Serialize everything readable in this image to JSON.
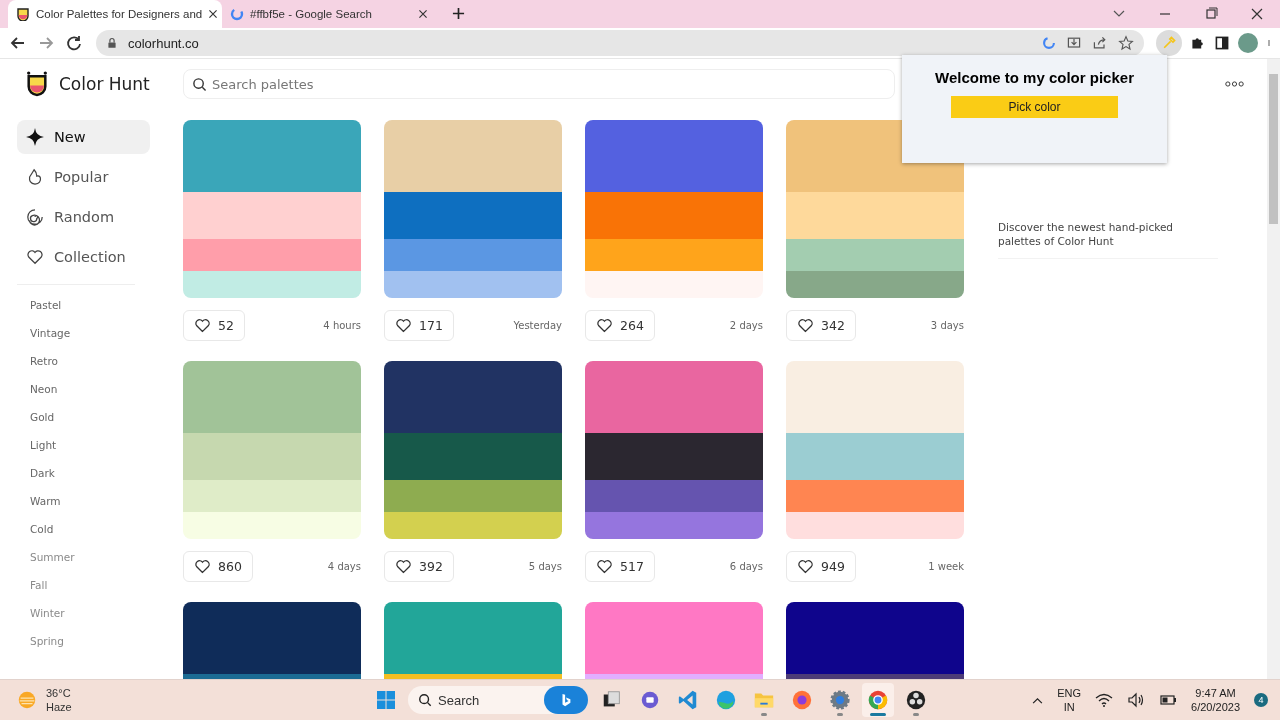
{
  "browser": {
    "tabs": [
      {
        "title": "Color Palettes for Designers and",
        "selected": true
      },
      {
        "title": "#ffbf5e - Google Search",
        "selected": false
      }
    ],
    "address": "colorhunt.co"
  },
  "site": {
    "logo": "Color Hunt",
    "search": {
      "placeholder": "Search palettes"
    },
    "nav": [
      {
        "label": "New",
        "selected": true
      },
      {
        "label": "Popular",
        "selected": false
      },
      {
        "label": "Random",
        "selected": false
      },
      {
        "label": "Collection",
        "selected": false
      }
    ],
    "tags": [
      "Pastel",
      "Vintage",
      "Retro",
      "Neon",
      "Gold",
      "Light",
      "Dark",
      "Warm",
      "Cold",
      "Summer",
      "Fall",
      "Winter",
      "Spring"
    ],
    "palettes": [
      {
        "swatches": [
          {
            "color": "#3aa6b9"
          },
          {
            "color": "#ffd0d0"
          },
          {
            "color": "#ff9eaa"
          },
          {
            "color": "#c1ece4"
          }
        ],
        "likes": "52",
        "time": "4 hours"
      },
      {
        "swatches": [
          {
            "color": "#e8cfa6"
          },
          {
            "color": "#0e6fc0"
          },
          {
            "color": "#5b97e3"
          },
          {
            "color": "#a1c1f0"
          }
        ],
        "likes": "171",
        "time": "Yesterday"
      },
      {
        "swatches": [
          {
            "color": "#5461e0"
          },
          {
            "color": "#f97306"
          },
          {
            "color": "#ffa41b"
          },
          {
            "color": "#fff5f3"
          }
        ],
        "likes": "264",
        "time": "2 days"
      },
      {
        "swatches": [
          {
            "color": "#f0c27b"
          },
          {
            "color": "#fed99b"
          },
          {
            "color": "#a3cdb0"
          },
          {
            "color": "#87a889"
          }
        ],
        "likes": "342",
        "time": "3 days"
      },
      {
        "swatches": [
          {
            "color": "#a1c398"
          },
          {
            "color": "#c6d8af"
          },
          {
            "color": "#dfecc8"
          },
          {
            "color": "#f7fde4"
          }
        ],
        "likes": "860",
        "time": "4 days"
      },
      {
        "swatches": [
          {
            "color": "#213363"
          },
          {
            "color": "#17594a"
          },
          {
            "color": "#8eac50"
          },
          {
            "color": "#d3d04f"
          }
        ],
        "likes": "392",
        "time": "5 days"
      },
      {
        "swatches": [
          {
            "color": "#e966a0"
          },
          {
            "color": "#2b2730"
          },
          {
            "color": "#6554af"
          },
          {
            "color": "#9575de"
          }
        ],
        "likes": "517",
        "time": "6 days"
      },
      {
        "swatches": [
          {
            "color": "#f9eee2"
          },
          {
            "color": "#9bcdd2"
          },
          {
            "color": "#ff8551"
          },
          {
            "color": "#ffdede"
          }
        ],
        "likes": "949",
        "time": "1 week"
      },
      {
        "swatches": [
          {
            "color": "#0f2c59"
          },
          {
            "color": "#1b6b93"
          }
        ]
      },
      {
        "swatches": [
          {
            "color": "#22a699"
          },
          {
            "color": "#f2be22"
          }
        ]
      },
      {
        "swatches": [
          {
            "color": "#ff78c4"
          },
          {
            "color": "#e1aeff"
          }
        ]
      },
      {
        "swatches": [
          {
            "color": "#0f058c"
          },
          {
            "color": "#4d3c77"
          }
        ]
      }
    ],
    "about": "Discover the newest hand-picked palettes of Color Hunt"
  },
  "popup": {
    "title": "Welcome to my color picker",
    "button": "Pick color"
  },
  "taskbar": {
    "temperature": "36°C",
    "weather": "Haze",
    "search": {
      "placeholder": "Search"
    },
    "apps": [
      {
        "running": false,
        "selected": false
      },
      {
        "running": false,
        "selected": false
      },
      {
        "running": false,
        "selected": false
      },
      {
        "running": false,
        "selected": false
      },
      {
        "running": true,
        "selected": false
      },
      {
        "running": false,
        "selected": false
      },
      {
        "running": true,
        "selected": false
      },
      {
        "running": true,
        "selected": true
      },
      {
        "running": true,
        "selected": false
      }
    ],
    "language": "ENG",
    "region": "IN",
    "time": "9:47 AM",
    "date": "6/20/2023",
    "notifications": "4"
  }
}
